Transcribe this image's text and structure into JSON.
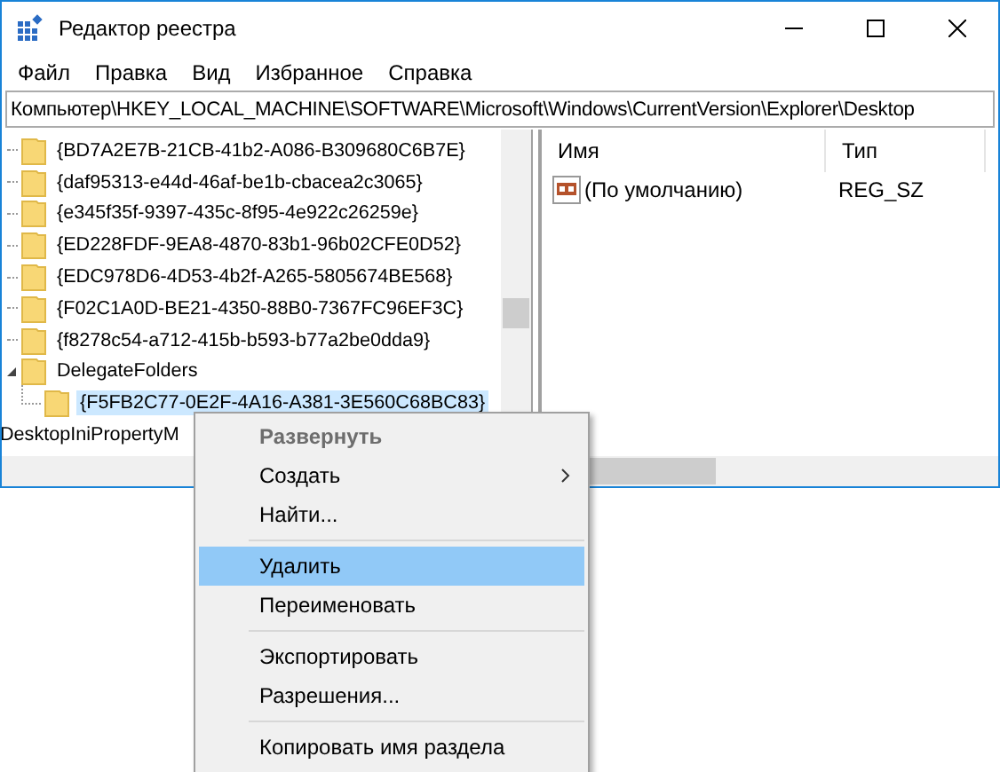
{
  "window": {
    "title": "Редактор реестра"
  },
  "menu_bar": [
    {
      "label": "Файл"
    },
    {
      "label": "Правка"
    },
    {
      "label": "Вид"
    },
    {
      "label": "Избранное"
    },
    {
      "label": "Справка"
    }
  ],
  "address_bar": {
    "value": "Компьютер\\HKEY_LOCAL_MACHINE\\SOFTWARE\\Microsoft\\Windows\\CurrentVersion\\Explorer\\Desktop"
  },
  "tree": {
    "items": [
      {
        "kind": "folder",
        "label": "{BD7A2E7B-21CB-41b2-A086-B309680C6B7E}",
        "selected": false
      },
      {
        "kind": "folder",
        "label": "{daf95313-e44d-46af-be1b-cbacea2c3065}",
        "selected": false
      },
      {
        "kind": "folder",
        "label": "{e345f35f-9397-435c-8f95-4e922c26259e}",
        "selected": false
      },
      {
        "kind": "folder",
        "label": "{ED228FDF-9EA8-4870-83b1-96b02CFE0D52}",
        "selected": false
      },
      {
        "kind": "folder",
        "label": "{EDC978D6-4D53-4b2f-A265-5805674BE568}",
        "selected": false
      },
      {
        "kind": "folder",
        "label": "{F02C1A0D-BE21-4350-88B0-7367FC96EF3C}",
        "selected": false
      },
      {
        "kind": "folder",
        "label": "{f8278c54-a712-415b-b593-b77a2be0dda9}",
        "selected": false
      },
      {
        "kind": "folder",
        "label": "DelegateFolders",
        "selected": false,
        "expanded": true,
        "children": [
          {
            "kind": "folder",
            "label": "{F5FB2C77-0E2F-4A16-A381-3E560C68BC83}",
            "selected": true
          }
        ]
      },
      {
        "kind": "outer",
        "label": "DesktopIniPropertyM",
        "selected": false
      }
    ]
  },
  "values": {
    "columns": [
      "Имя",
      "Тип"
    ],
    "rows": [
      {
        "name": "(По умолчанию)",
        "type": "REG_SZ"
      }
    ]
  },
  "context_menu": {
    "items": [
      {
        "kind": "item",
        "label": "Развернуть",
        "default": true,
        "disabled": true,
        "selected": false
      },
      {
        "kind": "item",
        "label": "Создать",
        "submenu": true,
        "selected": false
      },
      {
        "kind": "item",
        "label": "Найти...",
        "selected": false
      },
      {
        "kind": "separator"
      },
      {
        "kind": "item",
        "label": "Удалить",
        "selected": true
      },
      {
        "kind": "item",
        "label": "Переименовать",
        "selected": false
      },
      {
        "kind": "separator"
      },
      {
        "kind": "item",
        "label": "Экспортировать",
        "selected": false
      },
      {
        "kind": "item",
        "label": "Разрешения...",
        "selected": false
      },
      {
        "kind": "separator"
      },
      {
        "kind": "item",
        "label": "Копировать имя раздела",
        "selected": false
      }
    ]
  }
}
